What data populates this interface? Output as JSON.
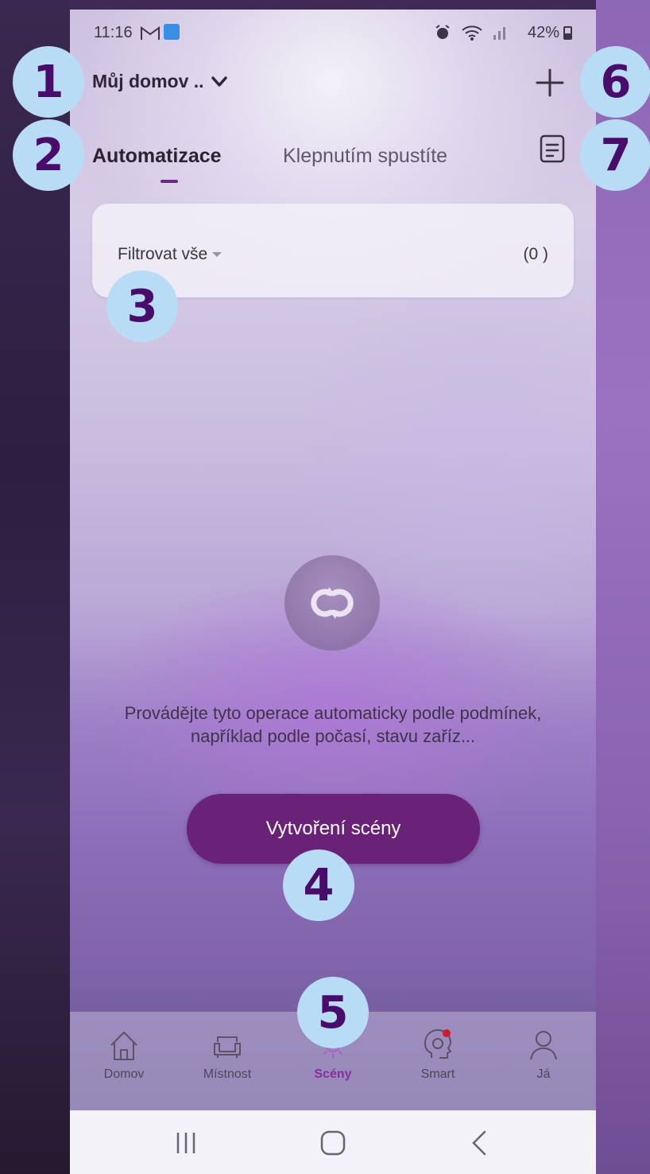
{
  "status_bar": {
    "time": "11:16",
    "right_text": "42%",
    "icons": [
      "gmail-icon",
      "app-notification-icon",
      "alarm-icon",
      "wifi-icon",
      "signal-icon",
      "battery-icon"
    ]
  },
  "header": {
    "home_name": "Můj domov ..",
    "add_icon": "plus-icon"
  },
  "tabs": [
    {
      "label": "Automatizace",
      "active": true
    },
    {
      "label": "Klepnutím spustíte",
      "active": false
    }
  ],
  "filter": {
    "label": "Filtrovat vše",
    "count": "(0 )"
  },
  "empty_state": {
    "icon": "loop-sync-icon",
    "text": "Provádějte tyto operace automaticky podle podmínek, například podle počasí, stavu zaříz...",
    "button_label": "Vytvoření scény"
  },
  "bottom_nav": [
    {
      "label": "Domov",
      "icon": "home-icon"
    },
    {
      "label": "Místnost",
      "icon": "armchair-icon"
    },
    {
      "label": "Scény",
      "icon": "sun-icon",
      "active": true
    },
    {
      "label": "Smart",
      "icon": "brain-icon"
    },
    {
      "label": "Já",
      "icon": "user-icon"
    }
  ],
  "badges": [
    "1",
    "2",
    "3",
    "4",
    "5",
    "6",
    "7"
  ],
  "colors": {
    "accent": "#6a2278",
    "active_nav": "#8a2ea0",
    "badge_bg": "#b9dcf6",
    "badge_text": "#4a0c6a"
  }
}
